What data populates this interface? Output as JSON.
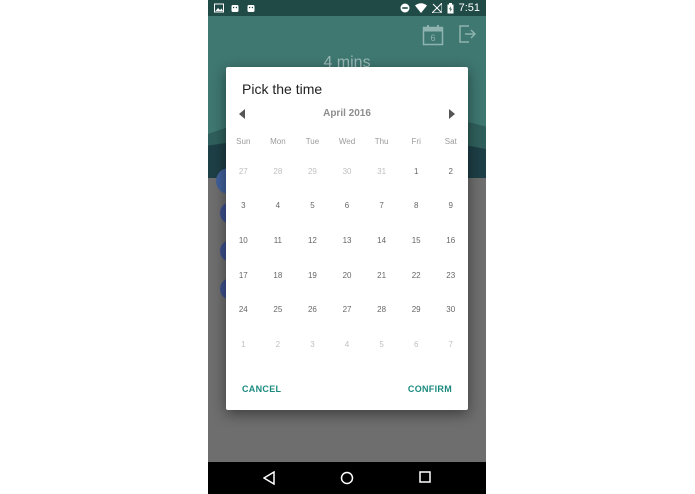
{
  "status_bar": {
    "time": "7:51",
    "left_icons": [
      "image-icon",
      "android-icon",
      "android-icon"
    ],
    "right_icons": [
      "do-not-disturb-icon",
      "wifi-icon",
      "no-signal-icon",
      "battery-icon"
    ]
  },
  "app": {
    "header_text": "4 mins",
    "calendar_icon_number": "6",
    "accent": "#3f7771"
  },
  "dialog": {
    "title": "Pick the time",
    "month": "April 2016",
    "weekdays": [
      "Sun",
      "Mon",
      "Tue",
      "Wed",
      "Thu",
      "Fri",
      "Sat"
    ],
    "weeks": [
      [
        {
          "d": "27",
          "muted": true
        },
        {
          "d": "28",
          "muted": true
        },
        {
          "d": "29",
          "muted": true
        },
        {
          "d": "30",
          "muted": true
        },
        {
          "d": "31",
          "muted": true
        },
        {
          "d": "1",
          "muted": false
        },
        {
          "d": "2",
          "muted": false
        }
      ],
      [
        {
          "d": "3",
          "muted": false
        },
        {
          "d": "4",
          "muted": false
        },
        {
          "d": "5",
          "muted": false
        },
        {
          "d": "6",
          "muted": false
        },
        {
          "d": "7",
          "muted": false
        },
        {
          "d": "8",
          "muted": false
        },
        {
          "d": "9",
          "muted": false
        }
      ],
      [
        {
          "d": "10",
          "muted": false
        },
        {
          "d": "11",
          "muted": false
        },
        {
          "d": "12",
          "muted": false
        },
        {
          "d": "13",
          "muted": false
        },
        {
          "d": "14",
          "muted": false
        },
        {
          "d": "15",
          "muted": false
        },
        {
          "d": "16",
          "muted": false
        }
      ],
      [
        {
          "d": "17",
          "muted": false
        },
        {
          "d": "18",
          "muted": false
        },
        {
          "d": "19",
          "muted": false
        },
        {
          "d": "20",
          "muted": false
        },
        {
          "d": "21",
          "muted": false
        },
        {
          "d": "22",
          "muted": false
        },
        {
          "d": "23",
          "muted": false
        }
      ],
      [
        {
          "d": "24",
          "muted": false
        },
        {
          "d": "25",
          "muted": false
        },
        {
          "d": "26",
          "muted": false
        },
        {
          "d": "27",
          "muted": false
        },
        {
          "d": "28",
          "muted": false
        },
        {
          "d": "29",
          "muted": false
        },
        {
          "d": "30",
          "muted": false
        }
      ],
      [
        {
          "d": "1",
          "muted": true
        },
        {
          "d": "2",
          "muted": true
        },
        {
          "d": "3",
          "muted": true
        },
        {
          "d": "4",
          "muted": true
        },
        {
          "d": "5",
          "muted": true
        },
        {
          "d": "6",
          "muted": true
        },
        {
          "d": "7",
          "muted": true
        }
      ]
    ],
    "cancel_label": "CANCEL",
    "confirm_label": "CONFIRM",
    "button_color": "#1b8a7f"
  },
  "nav_bar": {
    "icons": [
      "back-icon",
      "home-icon",
      "recents-icon"
    ]
  }
}
